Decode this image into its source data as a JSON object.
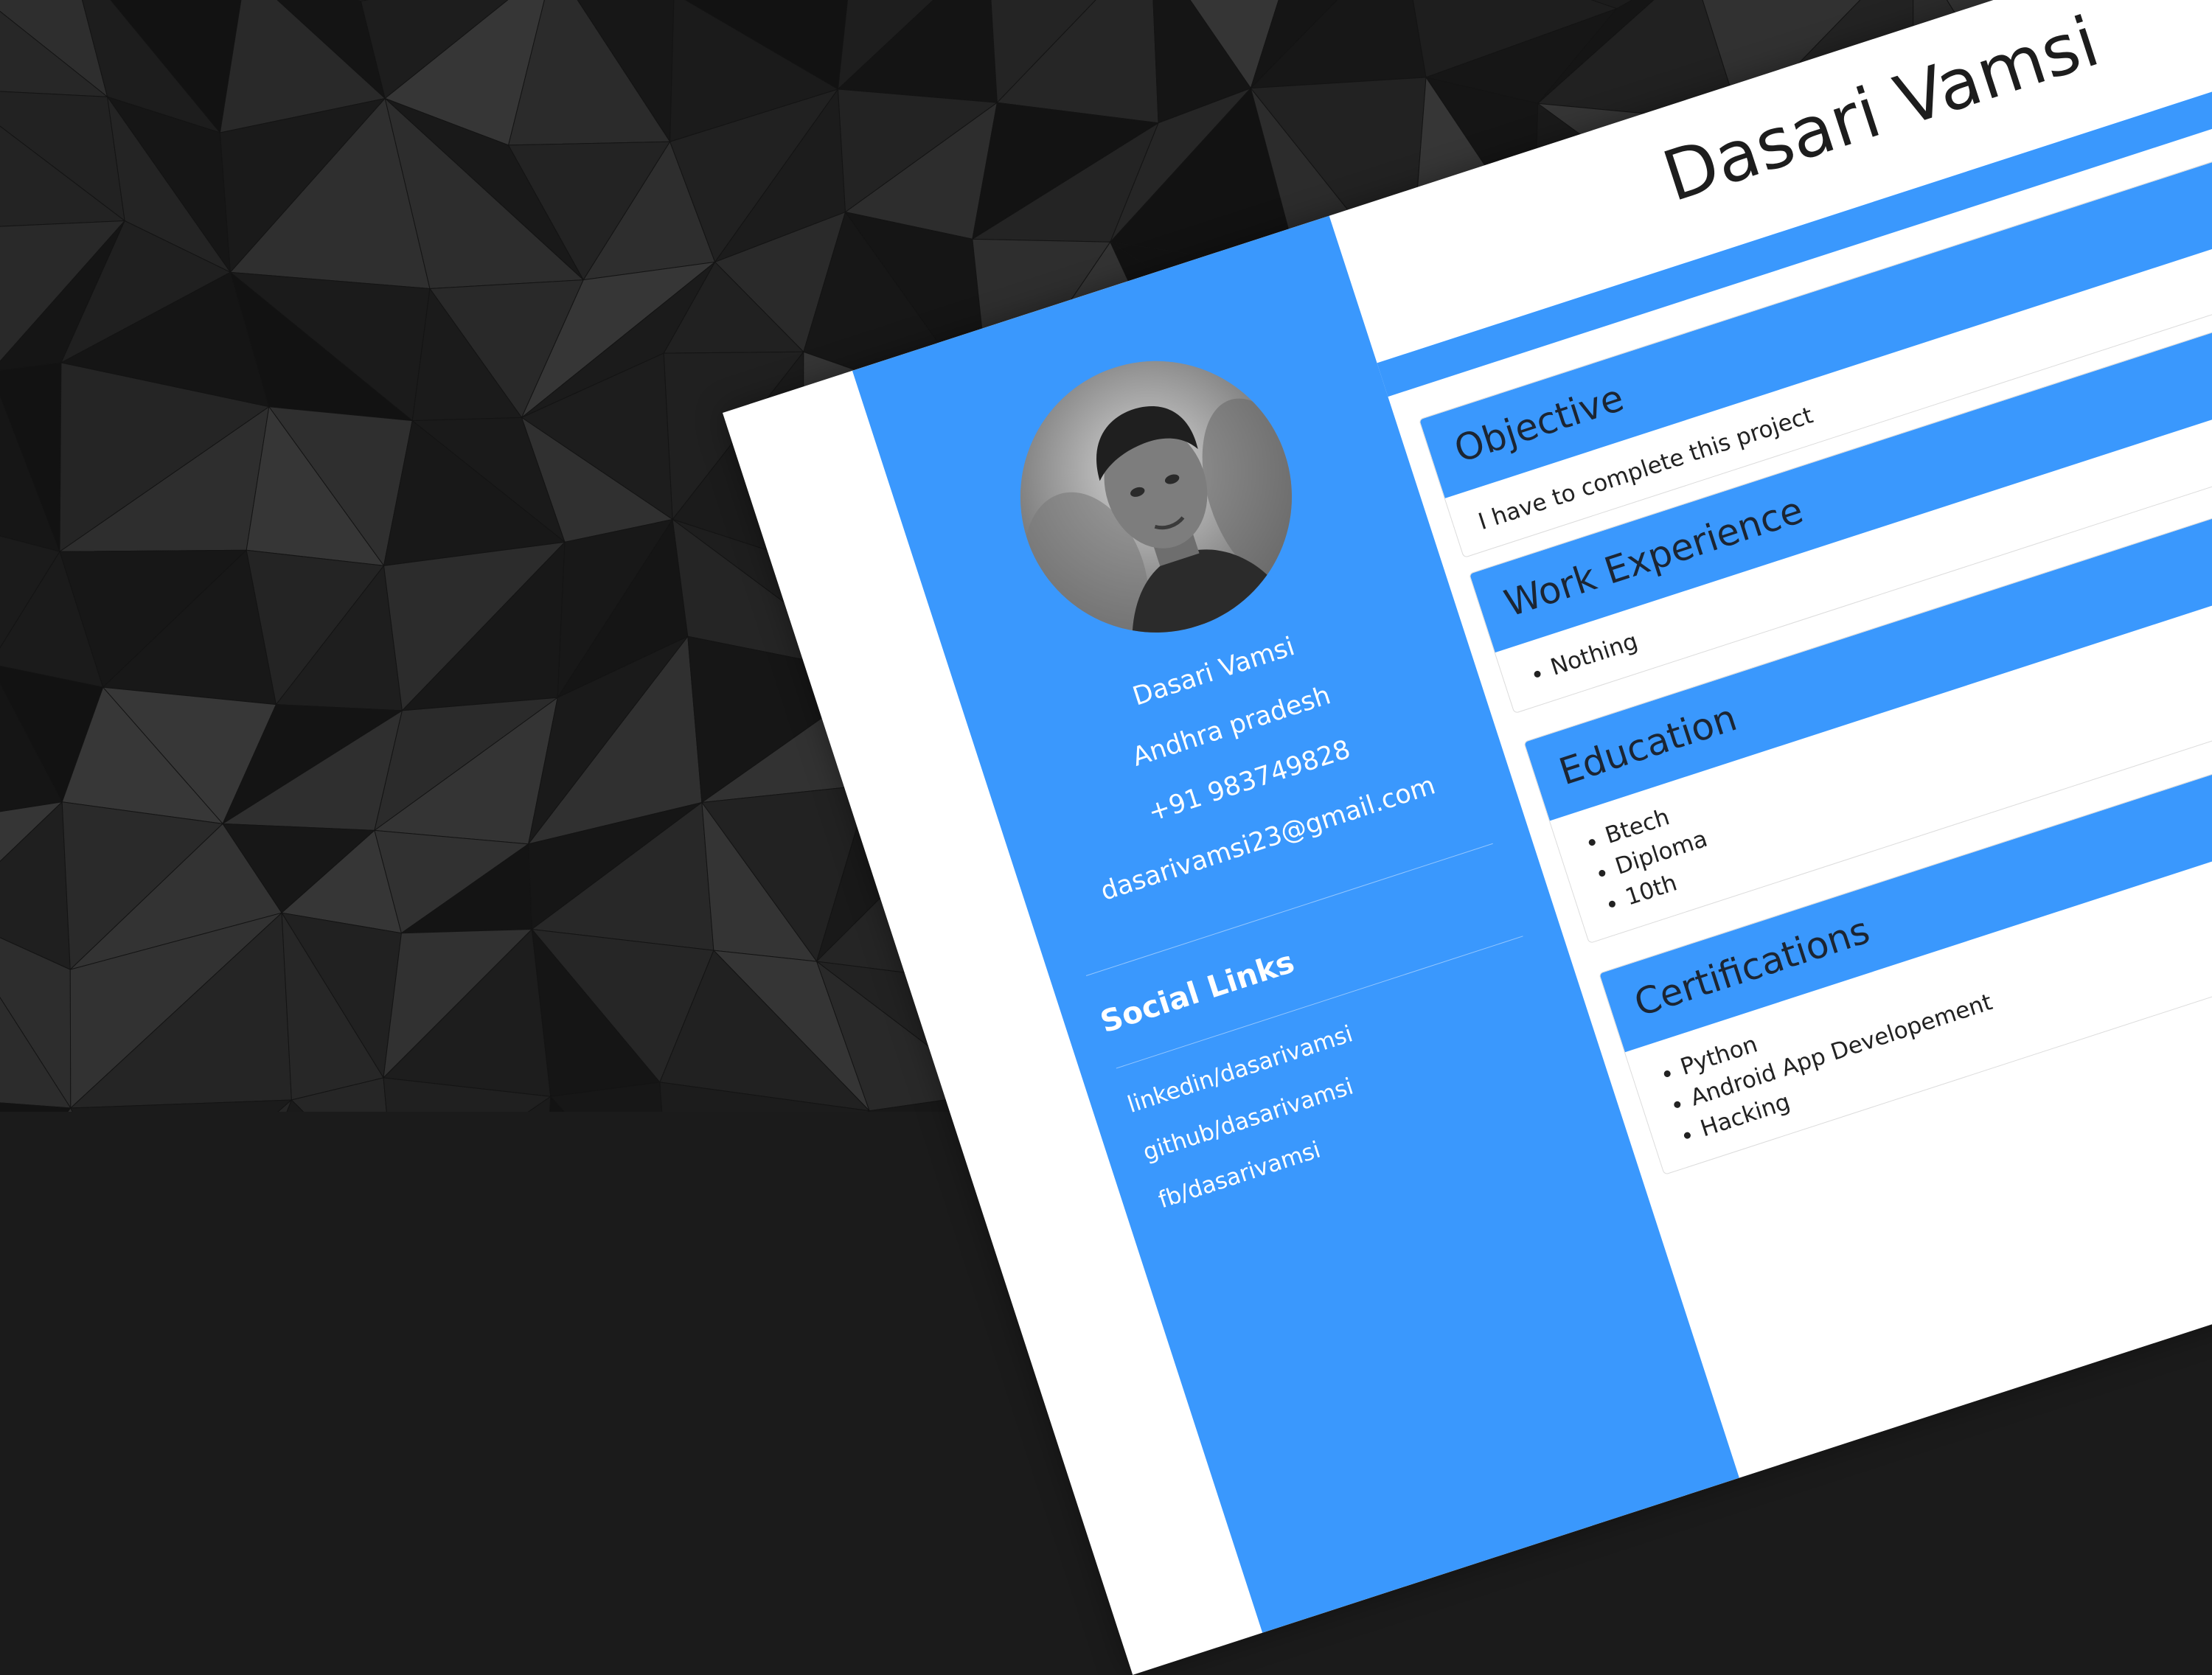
{
  "header": {
    "name": "Dasari Vamsi"
  },
  "profile": {
    "name": "Dasari Vamsi",
    "location": "Andhra pradesh",
    "phone": "+91 983749828",
    "email": "dasarivamsi23@gmail.com"
  },
  "social": {
    "title": "Social Links",
    "links": [
      "linkedin/dasarivamsi",
      "github/dasarivamsi",
      "fb/dasarivamsi"
    ]
  },
  "sections": {
    "objective": {
      "title": "Objective",
      "text": "I have to complete this project"
    },
    "work": {
      "title": "Work Experience",
      "items": [
        "Nothing"
      ]
    },
    "education": {
      "title": "Education",
      "items": [
        "Btech",
        "Diploma",
        "10th"
      ]
    },
    "certifications": {
      "title": "Certifications",
      "items": [
        "Python",
        "Android App Developement",
        "Hacking"
      ]
    }
  },
  "colors": {
    "accent": "#3a98fd",
    "background": "#1b1b1b",
    "title_text": "#1d1d1d"
  },
  "icons": {
    "avatar": "profile-photo"
  }
}
